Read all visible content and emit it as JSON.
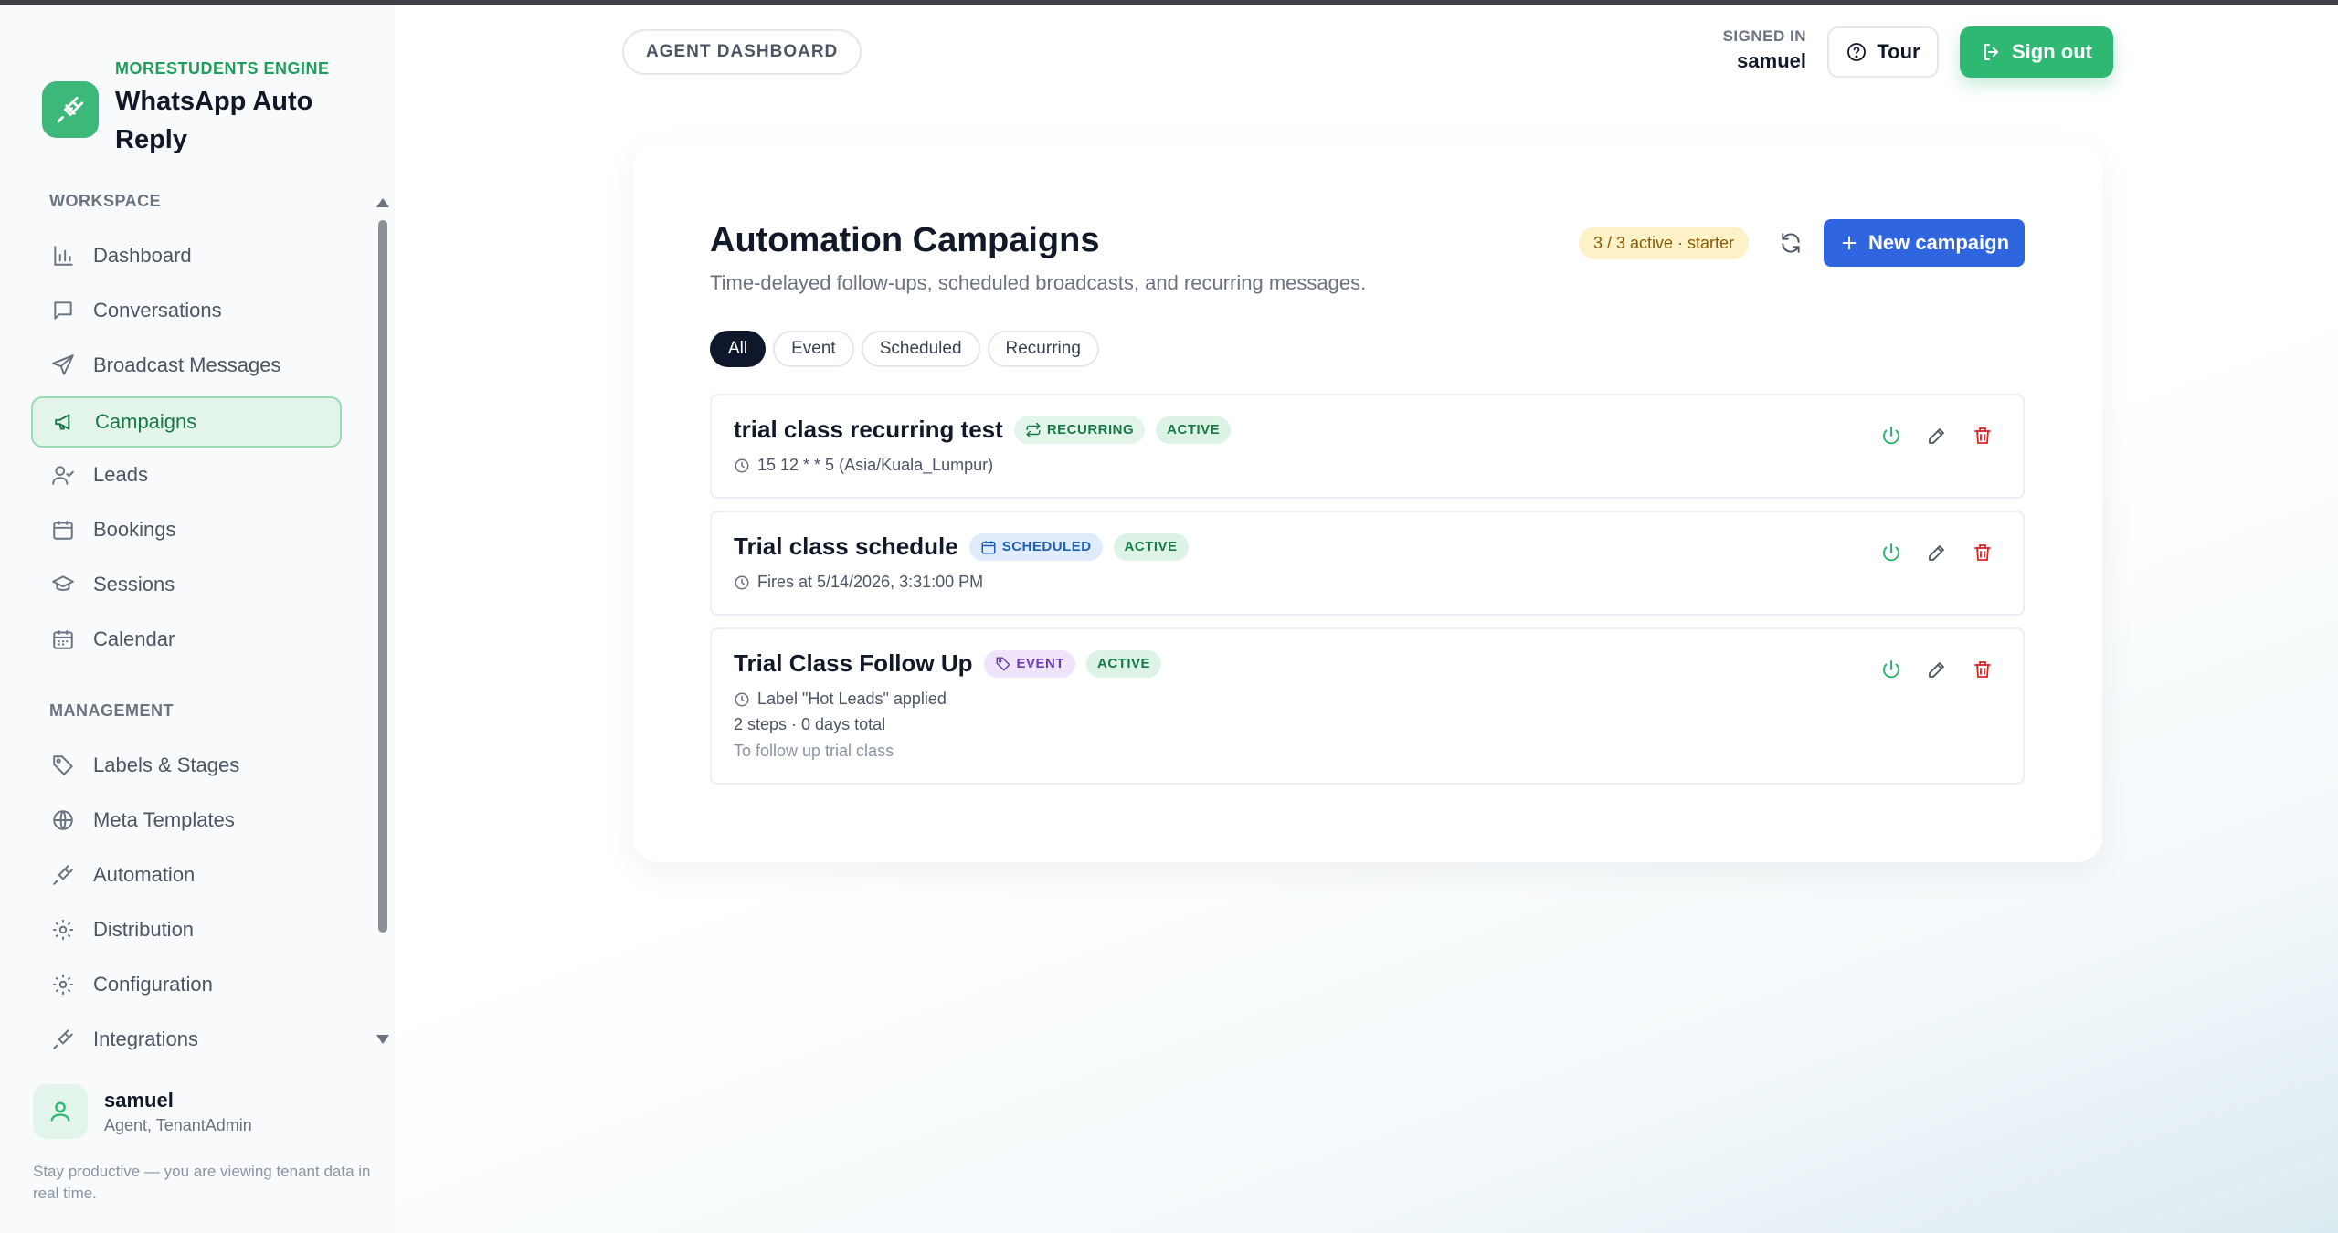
{
  "brand": {
    "eyebrow": "MORESTUDENTS ENGINE",
    "title": "WhatsApp Auto Reply"
  },
  "sidebar": {
    "workspace_label": "WORKSPACE",
    "management_label": "MANAGEMENT",
    "workspace_items": [
      {
        "label": "Dashboard",
        "icon": "bar-chart-icon"
      },
      {
        "label": "Conversations",
        "icon": "chat-bubble-icon"
      },
      {
        "label": "Broadcast Messages",
        "icon": "send-icon"
      },
      {
        "label": "Campaigns",
        "icon": "megaphone-icon",
        "active": true
      },
      {
        "label": "Leads",
        "icon": "user-check-icon"
      },
      {
        "label": "Bookings",
        "icon": "calendar-icon"
      },
      {
        "label": "Sessions",
        "icon": "graduation-cap-icon"
      },
      {
        "label": "Calendar",
        "icon": "calendar-grid-icon"
      }
    ],
    "management_items": [
      {
        "label": "Labels & Stages",
        "icon": "tag-icon"
      },
      {
        "label": "Meta Templates",
        "icon": "globe-icon"
      },
      {
        "label": "Automation",
        "icon": "plug-icon"
      },
      {
        "label": "Distribution",
        "icon": "gear-icon"
      },
      {
        "label": "Configuration",
        "icon": "gear-icon"
      },
      {
        "label": "Integrations",
        "icon": "plug-icon"
      }
    ],
    "user": {
      "name": "samuel",
      "role": "Agent, TenantAdmin"
    },
    "footer_note": "Stay productive — you are viewing tenant data in real time."
  },
  "header": {
    "breadcrumb": "AGENT DASHBOARD",
    "signed_in_label": "SIGNED IN",
    "signed_in_user": "samuel",
    "tour_label": "Tour",
    "signout_label": "Sign out"
  },
  "main": {
    "title": "Automation Campaigns",
    "subtitle": "Time-delayed follow-ups, scheduled broadcasts, and recurring messages.",
    "quota": "3 / 3 active · starter",
    "new_campaign_label": "New campaign",
    "filters": [
      "All",
      "Event",
      "Scheduled",
      "Recurring"
    ],
    "active_filter": "All",
    "campaigns": [
      {
        "name": "trial class recurring test",
        "type_label": "RECURRING",
        "status_label": "ACTIVE",
        "meta": "15 12 * * 5 (Asia/Kuala_Lumpur)"
      },
      {
        "name": "Trial class schedule",
        "type_label": "SCHEDULED",
        "status_label": "ACTIVE",
        "meta": "Fires at 5/14/2026, 3:31:00 PM"
      },
      {
        "name": "Trial Class Follow Up",
        "type_label": "EVENT",
        "status_label": "ACTIVE",
        "meta": "Label \"Hot Leads\" applied",
        "steps": "2 steps · 0 days total",
        "note": "To follow up trial class"
      }
    ]
  },
  "colors": {
    "brand_green": "#2fb872",
    "primary_blue": "#2f66e0",
    "danger_red": "#dc2626",
    "quota_bg": "#fdf1c7"
  }
}
